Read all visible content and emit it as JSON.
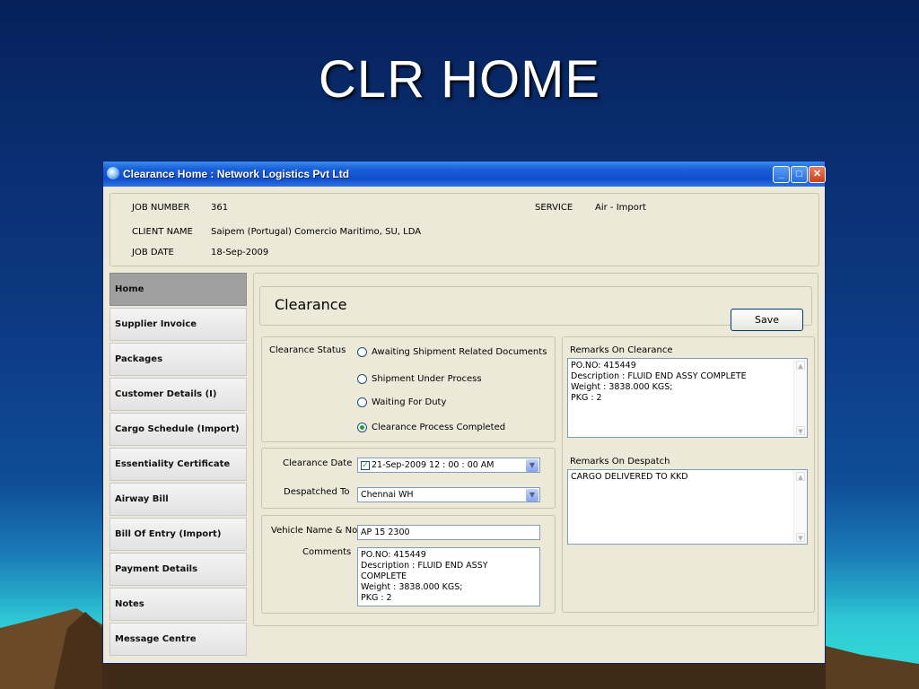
{
  "slide": {
    "title": "CLR HOME"
  },
  "window": {
    "title": "Clearance  Home : Network Logistics Pvt Ltd",
    "buttons": {
      "minimize": "_",
      "maximize": "□",
      "close": "✕"
    }
  },
  "header": {
    "job_number_label": "JOB NUMBER",
    "job_number": "361",
    "service_label": "SERVICE",
    "service": "Air - Import",
    "client_name_label": "CLIENT NAME",
    "client_name": "Saipem (Portugal) Comercio Maritimo, SU, LDA",
    "job_date_label": "JOB DATE",
    "job_date": "18-Sep-2009"
  },
  "nav": {
    "items": [
      {
        "label": "Home",
        "active": true
      },
      {
        "label": "Supplier Invoice"
      },
      {
        "label": "Packages"
      },
      {
        "label": "Customer Details (I)"
      },
      {
        "label": "Cargo Schedule (Import)"
      },
      {
        "label": "Essentiality Certificate"
      },
      {
        "label": "Airway Bill"
      },
      {
        "label": "Bill Of Entry (Import)"
      },
      {
        "label": "Payment Details"
      },
      {
        "label": "Notes"
      },
      {
        "label": "Message Centre"
      }
    ]
  },
  "main": {
    "heading": "Clearance",
    "save_label": "Save",
    "clearance_status_label": "Clearance Status",
    "status_options": [
      {
        "label": "Awaiting Shipment Related Documents",
        "checked": false
      },
      {
        "label": "Shipment Under Process",
        "checked": false
      },
      {
        "label": "Waiting For Duty",
        "checked": false
      },
      {
        "label": "Clearance Process Completed",
        "checked": true
      }
    ],
    "clearance_date_label": "Clearance Date",
    "clearance_date": "21-Sep-2009 12 : 00 : 00 AM",
    "despatched_to_label": "Despatched To",
    "despatched_to": "Chennai WH",
    "vehicle_label": "Vehicle Name & No",
    "vehicle": "AP 15 2300",
    "comments_label": "Comments",
    "comments": "PO.NO: 415449\nDescription : FLUID END ASSY\nCOMPLETE\nWeight : 3838.000 KGS;\nPKG : 2",
    "remarks_clearance_label": "Remarks On Clearance",
    "remarks_clearance": "PO.NO: 415449\nDescription : FLUID END ASSY COMPLETE\nWeight : 3838.000 KGS;\nPKG : 2",
    "remarks_despatch_label": "Remarks On Despatch",
    "remarks_despatch": "CARGO DELIVERED TO KKD"
  }
}
